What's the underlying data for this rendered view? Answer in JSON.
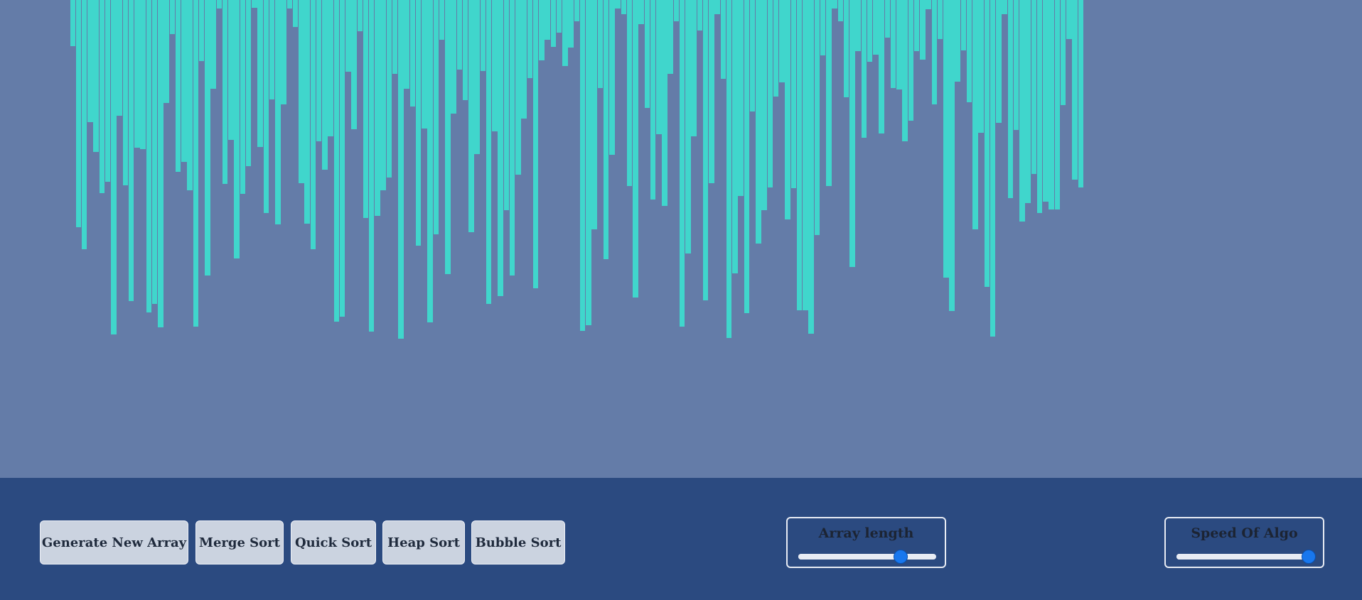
{
  "visualizer": {
    "bar_color": "#40d6cc",
    "background_color": "#647ca8",
    "bar_values": [
      65,
      320,
      351,
      172,
      214,
      272,
      256,
      471,
      163,
      261,
      424,
      208,
      210,
      440,
      428,
      461,
      145,
      48,
      242,
      228,
      268,
      460,
      86,
      388,
      125,
      12,
      259,
      197,
      364,
      273,
      234,
      11,
      207,
      300,
      140,
      316,
      147,
      12,
      38,
      258,
      315,
      351,
      199,
      239,
      192,
      453,
      446,
      101,
      182,
      44,
      307,
      467,
      304,
      268,
      250,
      104,
      477,
      125,
      150,
      346,
      181,
      454,
      330,
      56,
      386,
      160,
      98,
      141,
      327,
      217,
      100,
      428,
      185,
      417,
      296,
      388,
      246,
      167,
      110,
      406,
      85,
      56,
      66,
      46,
      93,
      67,
      30,
      466,
      458,
      323,
      124,
      365,
      218,
      12,
      20,
      262,
      419,
      34,
      152,
      281,
      189,
      290,
      104,
      30,
      460,
      357,
      192,
      43,
      423,
      258,
      20,
      111,
      476,
      385,
      276,
      441,
      157,
      343,
      296,
      264,
      136,
      116,
      309,
      265,
      437,
      437,
      470,
      331,
      78,
      262,
      12,
      30,
      137,
      376,
      72,
      194,
      87,
      77,
      188,
      53,
      124,
      126,
      199,
      170,
      72,
      84,
      13,
      147,
      55,
      391,
      438,
      115,
      71,
      144,
      323,
      187,
      404,
      474,
      173,
      20,
      279,
      183,
      312,
      286,
      245,
      300,
      284,
      295,
      295,
      148,
      55,
      253,
      264
    ],
    "bar_start_x": 98.5,
    "bar_pitch": 8.245
  },
  "controls": {
    "buttons": [
      {
        "label": "Generate New Array",
        "name": "generate-new-array-button"
      },
      {
        "label": "Merge Sort",
        "name": "merge-sort-button"
      },
      {
        "label": "Quick Sort",
        "name": "quick-sort-button"
      },
      {
        "label": "Heap Sort",
        "name": "heap-sort-button"
      },
      {
        "label": "Bubble Sort",
        "name": "bubble-sort-button"
      }
    ],
    "array_length": {
      "label": "Array length",
      "value_fraction": 0.74
    },
    "speed": {
      "label": "Speed Of Algo",
      "value_fraction": 1.0
    },
    "accent_color": "#1877ee",
    "panel_color": "#2b4a80"
  }
}
